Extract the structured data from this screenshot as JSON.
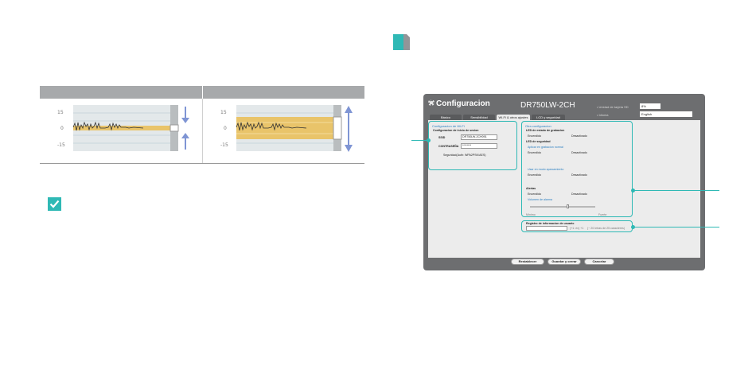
{
  "waveform": {
    "left_ticks": [
      "-15",
      "0",
      "15"
    ],
    "right_ticks": [
      "-15",
      "0",
      "15"
    ],
    "colors": {
      "track": "#e9c46a",
      "arrow": "#7f95d4",
      "grid": "#c8d6dc"
    }
  },
  "device_ui": {
    "title": "Configuracion",
    "model": "DR750LW-2CH",
    "header_fields": [
      {
        "label": "• Unidad de tarjeta SD",
        "value": "8%"
      },
      {
        "label": "• Idioma",
        "value": "English"
      }
    ],
    "tabs": [
      "Básico",
      "Sensibilidad",
      "Wi-Fi & otros ajustes",
      "LCD y seguridad"
    ],
    "active_tab": 2,
    "wifi": {
      "title": "Configuracion de Wi-Fi",
      "login_heading": "Configuracion de inicio de sesion",
      "ssid_label": "SSID",
      "ssid_value": "DR750LW-2CH091",
      "password_label": "CONTRASEÑA",
      "password_value": "********",
      "security_label": "Seguridad(Auth: WPA2PSK/AES)"
    },
    "other": {
      "title": "Otra configuracion",
      "rec_led_heading": "LED de estado de grabacion",
      "on": "Encendido",
      "off": "Desactivado",
      "sec_led_heading": "LED de seguridad",
      "apply_parking": "Aplicar en grabacion normal",
      "parking_mode": "Usar en modo aparcamiento",
      "alerts_heading": "Alertas",
      "volume_label": "Volumen de alarma",
      "min_label": "Mínimo",
      "max_label": "Fuerte"
    },
    "user_info": {
      "title": "Registro de informacion de usuario",
      "hint": "(+1: ex) +1",
      "limit": "(~ 20 letras de 25 caracteres)"
    },
    "buttons": [
      "Restablecer",
      "Guardar y cerrar",
      "Cancelar"
    ]
  },
  "colors": {
    "accent": "#2fb9b5",
    "table_header": "#a7a9ab",
    "window": "#6d6e70"
  }
}
